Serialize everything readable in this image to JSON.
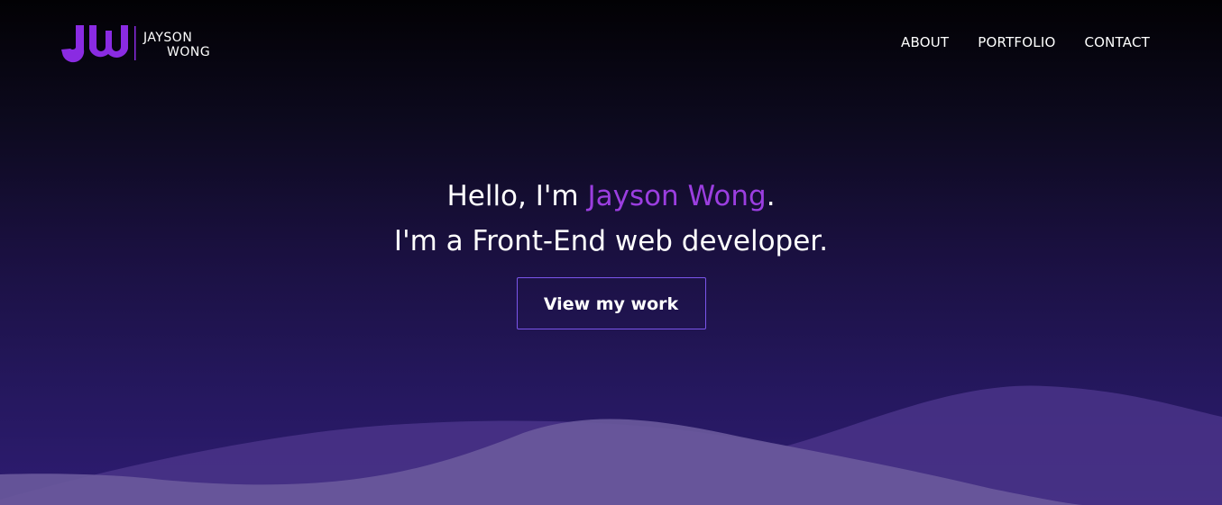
{
  "brand": {
    "logo_mark": "JW",
    "name_line1": "JAYSON",
    "name_line2": "WONG",
    "accent_color": "#9b3ee0",
    "mark_color": "#8a2be2"
  },
  "nav": {
    "items": [
      {
        "label": "ABOUT"
      },
      {
        "label": "PORTFOLIO"
      },
      {
        "label": "CONTACT"
      }
    ]
  },
  "hero": {
    "greeting_prefix": "Hello, I'm ",
    "name": "Jayson Wong",
    "greeting_suffix": ".",
    "tagline": "I'm a Front-End web developer.",
    "cta_label": "View my work"
  },
  "colors": {
    "background_top": "#020104",
    "background_bottom": "#2e1c72",
    "button_border": "#7a55ea",
    "wave_back": "#4a3488",
    "wave_front": "#6a5a9c"
  }
}
